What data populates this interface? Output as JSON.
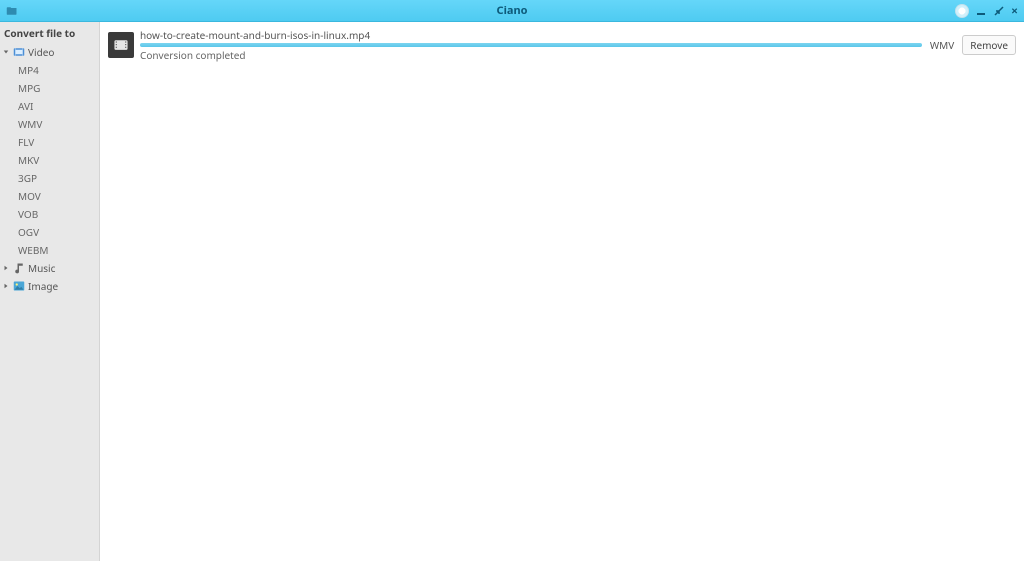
{
  "header": {
    "title": "Ciano"
  },
  "sidebar": {
    "header": "Convert file to",
    "groups": [
      {
        "label": "Video",
        "expanded": true,
        "icon": "video",
        "items": [
          "MP4",
          "MPG",
          "AVI",
          "WMV",
          "FLV",
          "MKV",
          "3GP",
          "MOV",
          "VOB",
          "OGV",
          "WEBM"
        ]
      },
      {
        "label": "Music",
        "expanded": false,
        "icon": "music",
        "items": []
      },
      {
        "label": "Image",
        "expanded": false,
        "icon": "image",
        "items": []
      }
    ]
  },
  "main": {
    "rows": [
      {
        "filename": "how-to-create-mount-and-burn-isos-in-linux.mp4",
        "status": "Conversion completed",
        "target_format": "WMV",
        "remove_label": "Remove",
        "progress": 100
      }
    ]
  }
}
